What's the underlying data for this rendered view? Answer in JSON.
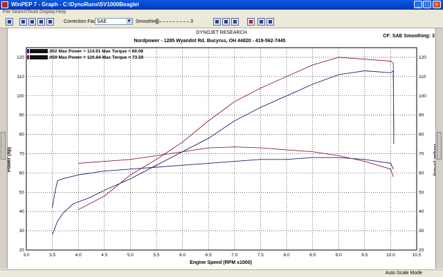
{
  "window": {
    "title": "WinPEP 7  -  Graph - C:\\DynoRuns\\SV1000Beagle\\",
    "minimize": "_",
    "maximize": "□",
    "close": "×"
  },
  "menu": [
    "File",
    "Search",
    "Tools",
    "Display",
    "Help"
  ],
  "toolbar": {
    "correction_label": "Correction Factor",
    "correction_value": "SAE",
    "smoothing_label": "Smoothing:",
    "smoothing_value": "3"
  },
  "header": {
    "company": "DYNOJET RESEARCH",
    "address": "Nordpower - 1285 Wyandot Rd. Bucyrus, OH  44820 - 419-562-7445",
    "cf": "CF: SAE  Smoothing: 3"
  },
  "legend": [
    {
      "text": ".002 Max Power = 114.91 Max Torque = 69.08",
      "color": "#1c1c6e"
    },
    {
      "text": ".059 Max Power = 120.84 Max Torque = 73.59",
      "color": "#8b1a3a"
    }
  ],
  "statusbar": {
    "text": "Auto Scale Mode"
  },
  "chart_data": {
    "type": "line",
    "xlabel": "Engine Speed (RPM x1000)",
    "ylabel": "Power (hp)",
    "y2label": "Torque (ft-lbs)",
    "xlim": [
      3.0,
      10.5
    ],
    "ylim": [
      20,
      125
    ],
    "y2lim": [
      20,
      125
    ],
    "xticks": [
      "3.0",
      "3.5",
      "4.0",
      "4.5",
      "5.0",
      "5.5",
      "6.0",
      "6.5",
      "7.0",
      "7.5",
      "8.0",
      "8.5",
      "9.0",
      "9.5",
      "10.0",
      "10.5"
    ],
    "yticks": [
      "20",
      "30",
      "40",
      "50",
      "60",
      "70",
      "80",
      "90",
      "100",
      "110",
      "120"
    ],
    "grid": true,
    "series": [
      {
        "name": ".002",
        "kind": "power",
        "color": "#1c1c6e",
        "x": [
          3.5,
          3.6,
          3.7,
          3.9,
          4.2,
          4.5,
          5.0,
          5.5,
          6.0,
          6.5,
          7.0,
          7.5,
          8.0,
          8.5,
          9.0,
          9.5,
          10.0,
          10.05,
          10.06
        ],
        "y": [
          28,
          35,
          39,
          44,
          47,
          51,
          57,
          64,
          71,
          78,
          87,
          94,
          100,
          106,
          111,
          113,
          112,
          113,
          75
        ]
      },
      {
        "name": ".002",
        "kind": "torque",
        "color": "#1c1c6e",
        "x": [
          3.5,
          3.55,
          3.6,
          3.7,
          4.0,
          4.5,
          5.0,
          5.5,
          6.0,
          6.5,
          7.0,
          7.5,
          8.0,
          8.5,
          9.0,
          9.5,
          10.0,
          10.05
        ],
        "y": [
          42,
          50,
          56,
          57,
          59,
          61,
          62,
          63,
          64,
          65,
          66,
          67,
          67,
          68,
          68,
          67,
          65,
          62
        ]
      },
      {
        "name": ".059",
        "kind": "power",
        "color": "#8b1a3a",
        "x": [
          4.0,
          4.5,
          5.0,
          5.5,
          6.0,
          6.5,
          7.0,
          7.5,
          8.0,
          8.5,
          9.0,
          9.5,
          10.0,
          10.05,
          10.06
        ],
        "y": [
          41,
          48,
          59,
          67,
          76,
          87,
          97,
          104,
          110,
          116,
          120,
          119,
          118,
          117,
          80
        ]
      },
      {
        "name": ".059",
        "kind": "torque",
        "color": "#8b1a3a",
        "x": [
          4.0,
          4.5,
          5.0,
          5.5,
          6.0,
          6.5,
          7.0,
          7.5,
          8.0,
          8.5,
          9.0,
          9.5,
          10.0,
          10.05
        ],
        "y": [
          65,
          66,
          67,
          69,
          71,
          73,
          73.5,
          73,
          72,
          71,
          69,
          66,
          62,
          58
        ]
      }
    ]
  }
}
